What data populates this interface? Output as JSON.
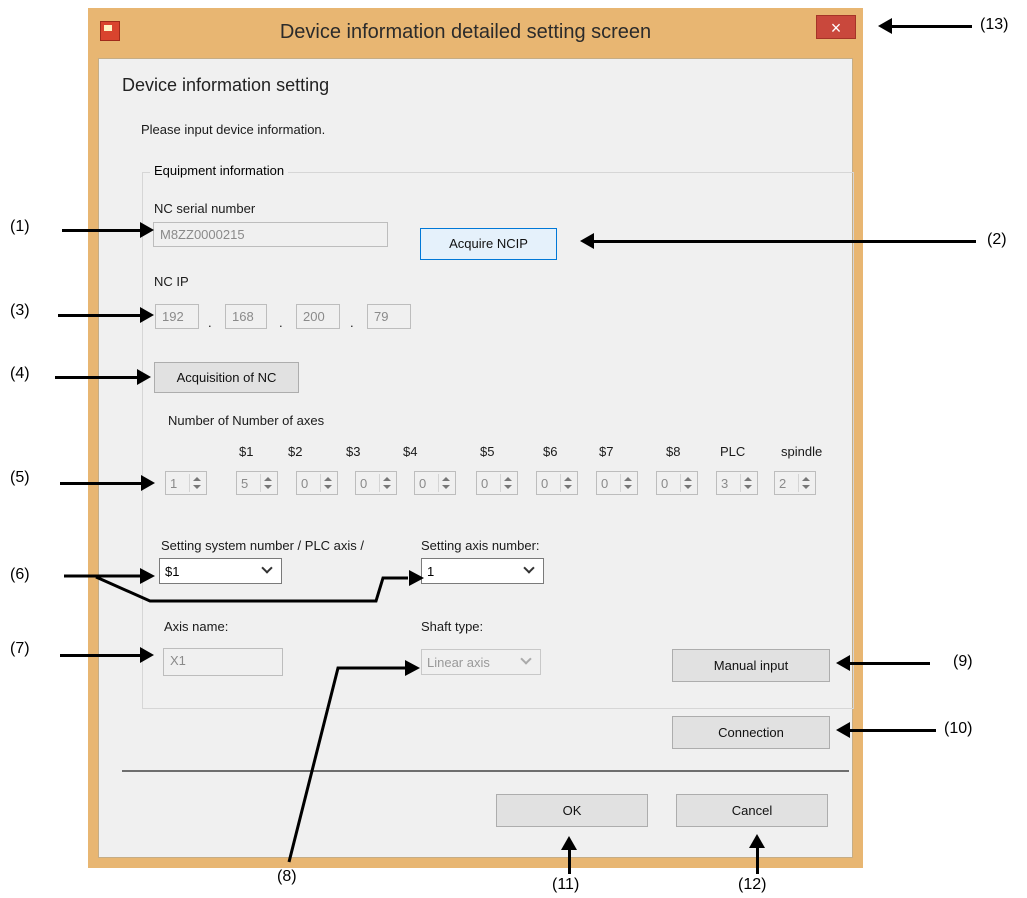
{
  "window": {
    "title": "Device information detailed setting screen",
    "close_glyph": "×",
    "app_icon": "app-icon"
  },
  "page": {
    "heading": "Device information setting",
    "instruction": "Please input device information."
  },
  "equipment": {
    "group_title": "Equipment information",
    "serial_label": "NC serial number",
    "serial_value": "M8ZZ0000215",
    "acquire_ncip_label": "Acquire NCIP",
    "ncip_label": "NC IP",
    "ip": [
      "192",
      "168",
      "200",
      "79"
    ],
    "ip_dot": ".",
    "acquisition_label": "Acquisition of NC",
    "count_label": "Number of  Number of axes",
    "axis_headers": [
      "$1",
      "$2",
      "$3",
      "$4",
      "$5",
      "$6",
      "$7",
      "$8",
      "PLC",
      "spindle"
    ],
    "spin_values": [
      "1",
      "5",
      "0",
      "0",
      "0",
      "0",
      "0",
      "0",
      "0",
      "3",
      "2"
    ],
    "system_label": "Setting system number / PLC axis /",
    "system_value": "$1",
    "axisnum_label": "Setting axis number:",
    "axisnum_value": "1",
    "axisname_label": "Axis name:",
    "axisname_value": "X1",
    "shaft_label": "Shaft type:",
    "shaft_value": "Linear axis",
    "manual_input_label": "Manual input"
  },
  "connection_label": "Connection",
  "ok_label": "OK",
  "cancel_label": "Cancel",
  "callouts": [
    "(1)",
    "(2)",
    "(3)",
    "(4)",
    "(5)",
    "(6)",
    "(7)",
    "(8)",
    "(9)",
    "(10)",
    "(11)",
    "(12)",
    "(13)"
  ]
}
